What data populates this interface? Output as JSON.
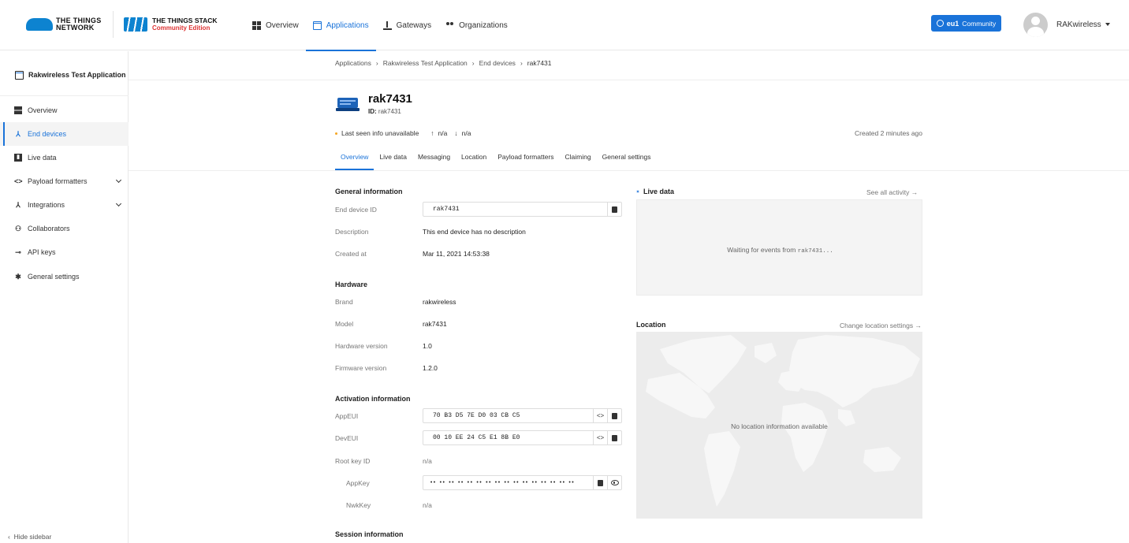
{
  "topbar": {
    "ttn_logo_line1": "THE THINGS",
    "ttn_logo_line2": "NETWORK",
    "tts_logo_line1": "THE THINGS STACK",
    "tts_logo_line2": "Community Edition",
    "nav": [
      {
        "label": "Overview",
        "icon": "grid-icon",
        "active": false
      },
      {
        "label": "Applications",
        "icon": "application-icon",
        "active": true
      },
      {
        "label": "Gateways",
        "icon": "gateway-icon",
        "active": false
      },
      {
        "label": "Organizations",
        "icon": "organization-icon",
        "active": false
      }
    ],
    "cluster_region": "eu1",
    "cluster_label": "Community",
    "user_name": "RAKwireless"
  },
  "sidebar": {
    "app_title": "Rakwireless Test Application",
    "items": [
      {
        "label": "Overview",
        "icon": "grid-icon"
      },
      {
        "label": "End devices",
        "icon": "end-devices-icon",
        "active": true
      },
      {
        "label": "Live data",
        "icon": "live-data-icon"
      },
      {
        "label": "Payload formatters",
        "icon": "code-icon",
        "expandable": true
      },
      {
        "label": "Integrations",
        "icon": "integrations-icon",
        "expandable": true
      },
      {
        "label": "Collaborators",
        "icon": "collaborators-icon"
      },
      {
        "label": "API keys",
        "icon": "key-icon"
      },
      {
        "label": "General settings",
        "icon": "gear-icon"
      }
    ],
    "hide_label": "Hide sidebar"
  },
  "breadcrumb": [
    "Applications",
    "Rakwireless Test Application",
    "End devices",
    "rak7431"
  ],
  "device": {
    "name": "rak7431",
    "id_label": "ID:",
    "id": "rak7431",
    "last_seen": "Last seen info unavailable",
    "uplink": "n/a",
    "downlink": "n/a",
    "created_ago": "Created 2 minutes ago"
  },
  "tabs": [
    "Overview",
    "Live data",
    "Messaging",
    "Location",
    "Payload formatters",
    "Claiming",
    "General settings"
  ],
  "general": {
    "title": "General information",
    "end_device_id_label": "End device ID",
    "end_device_id": "rak7431",
    "description_label": "Description",
    "description": "This end device has no description",
    "created_at_label": "Created at",
    "created_at": "Mar 11, 2021 14:53:38"
  },
  "hardware": {
    "title": "Hardware",
    "brand_label": "Brand",
    "brand": "rakwireless",
    "model_label": "Model",
    "model": "rak7431",
    "hw_version_label": "Hardware version",
    "hw_version": "1.0",
    "fw_version_label": "Firmware version",
    "fw_version": "1.2.0"
  },
  "activation": {
    "title": "Activation information",
    "appeui_label": "AppEUI",
    "appeui": "70 B3 D5 7E D0 03 CB C5",
    "deveui_label": "DevEUI",
    "deveui": "00 10 EE 24 C5 E1 8B E0",
    "root_key_label": "Root key ID",
    "root_key": "n/a",
    "appkey_label": "AppKey",
    "appkey": "•• •• •• •• •• •• •• •• •• •• •• •• •• •• •• ••",
    "nwkkey_label": "NwkKey",
    "nwkkey": "n/a"
  },
  "session": {
    "title": "Session information"
  },
  "live_panel": {
    "title": "Live data",
    "link": "See all activity →",
    "waiting_prefix": "Waiting for events from",
    "waiting_device": "rak7431..."
  },
  "location_panel": {
    "title": "Location",
    "link": "Change location settings →",
    "empty": "No location information available"
  }
}
